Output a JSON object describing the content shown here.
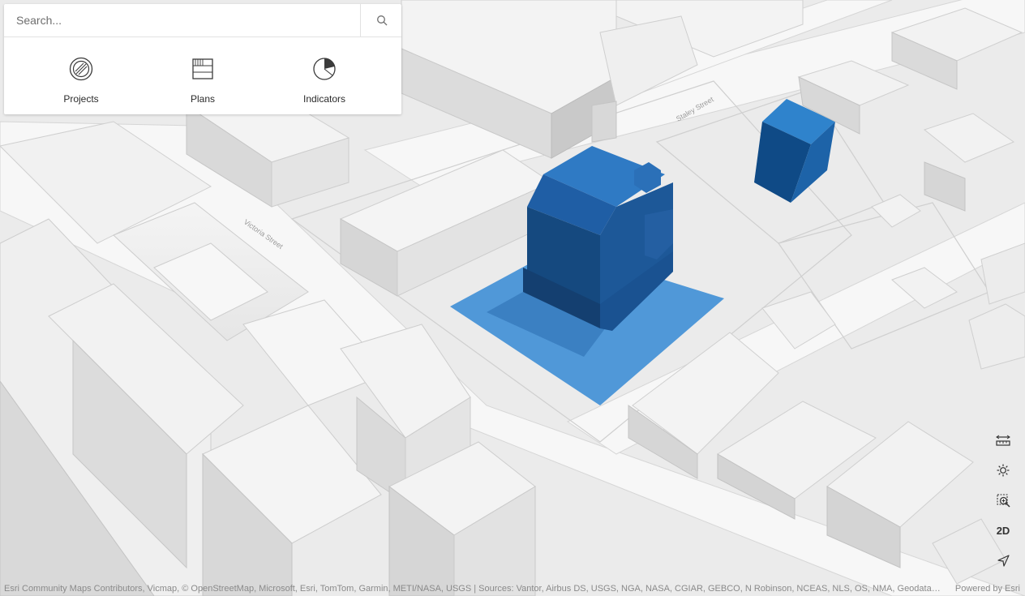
{
  "search": {
    "placeholder": "Search..."
  },
  "shortcuts": [
    {
      "label": "Projects",
      "icon": "projects-icon"
    },
    {
      "label": "Plans",
      "icon": "plans-icon"
    },
    {
      "label": "Indicators",
      "icon": "indicators-icon"
    }
  ],
  "map": {
    "street_labels": [
      "Staley Street",
      "Victoria Street"
    ],
    "highlight_color": "#2d7dc6"
  },
  "tools": {
    "measure": "measure-icon",
    "daylight": "sun-icon",
    "zoom_area": "zoom-area-icon",
    "view_toggle_label": "2D",
    "locate": "locate-arrow-icon"
  },
  "attribution": {
    "text": "Esri Community Maps Contributors, Vicmap, © OpenStreetMap, Microsoft, Esri, TomTom, Garmin, METI/NASA, USGS | Sources: Vantor, Airbus DS, USGS, NGA, NASA, CGIAR, GEBCO, N Robinson, NCEAS, NLS, OS, NMA, Geodatastyrelsen, Rijkswaterstaat, GSA, Geoland, FEMA, Intermap and the GIS user community",
    "powered_by": "Powered by Esri"
  }
}
